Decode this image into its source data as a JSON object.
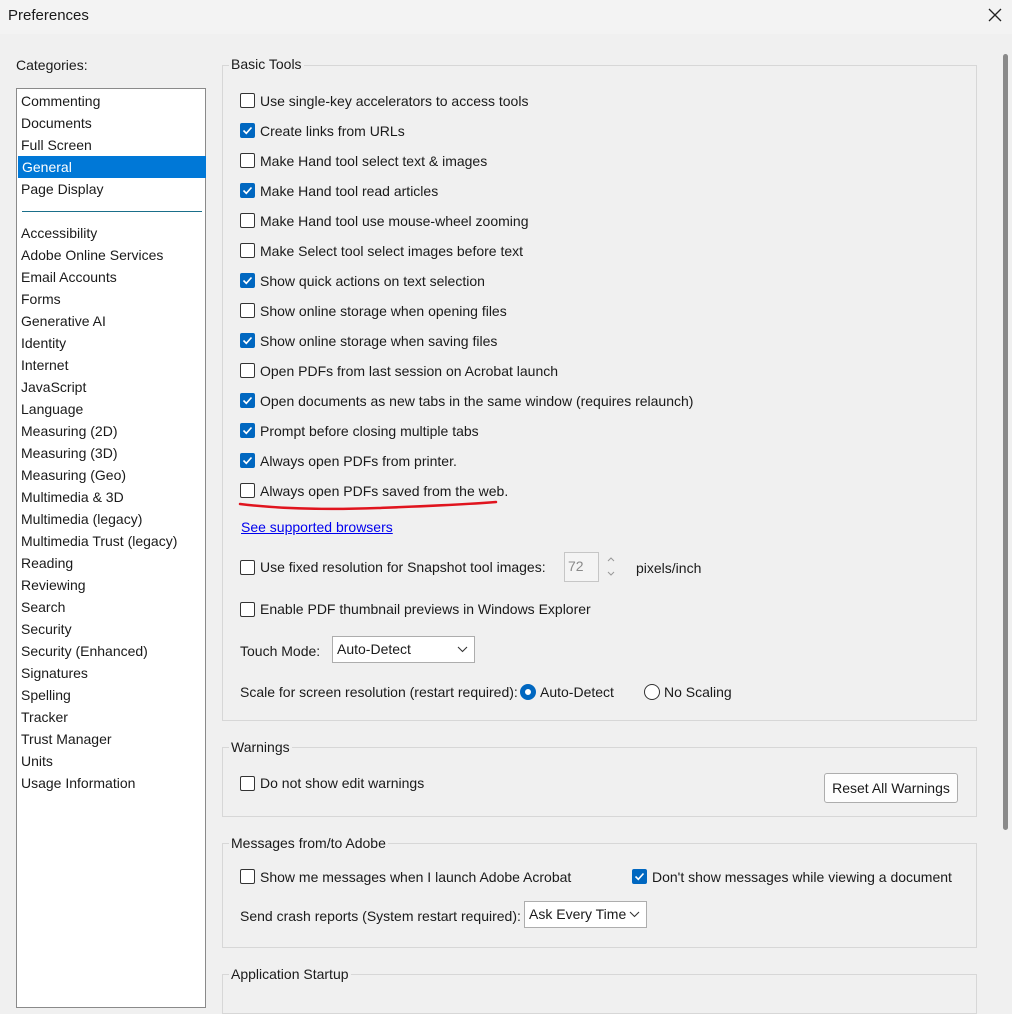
{
  "window": {
    "title": "Preferences",
    "close_icon": "close-icon"
  },
  "categories": {
    "label": "Categories:",
    "top_items": [
      "Commenting",
      "Documents",
      "Full Screen",
      "General",
      "Page Display"
    ],
    "selected": "General",
    "items": [
      "Accessibility",
      "Adobe Online Services",
      "Email Accounts",
      "Forms",
      "Generative AI",
      "Identity",
      "Internet",
      "JavaScript",
      "Language",
      "Measuring (2D)",
      "Measuring (3D)",
      "Measuring (Geo)",
      "Multimedia & 3D",
      "Multimedia (legacy)",
      "Multimedia Trust (legacy)",
      "Reading",
      "Reviewing",
      "Search",
      "Security",
      "Security (Enhanced)",
      "Signatures",
      "Spelling",
      "Tracker",
      "Trust Manager",
      "Units",
      "Usage Information"
    ]
  },
  "basic_tools": {
    "label": "Basic Tools",
    "options": [
      {
        "label": "Use single-key accelerators to access tools",
        "checked": false
      },
      {
        "label": "Create links from URLs",
        "checked": true
      },
      {
        "label": "Make Hand tool select text & images",
        "checked": false
      },
      {
        "label": "Make Hand tool read articles",
        "checked": true
      },
      {
        "label": "Make Hand tool use mouse-wheel zooming",
        "checked": false
      },
      {
        "label": "Make Select tool select images before text",
        "checked": false
      },
      {
        "label": "Show quick actions on text selection",
        "checked": true
      },
      {
        "label": "Show online storage when opening files",
        "checked": false
      },
      {
        "label": "Show online storage when saving files",
        "checked": true
      },
      {
        "label": "Open PDFs from last session on Acrobat launch",
        "checked": false
      },
      {
        "label": "Open documents as new tabs in the same window (requires relaunch)",
        "checked": true
      },
      {
        "label": "Prompt before closing multiple tabs",
        "checked": true
      },
      {
        "label": "Always open PDFs from printer.",
        "checked": true
      },
      {
        "label": "Always open PDFs saved from the web.",
        "checked": false
      }
    ],
    "see_browsers_link": "See supported browsers",
    "fixed_resolution": {
      "label": "Use fixed resolution for Snapshot tool images:",
      "checked": false,
      "value": "72",
      "unit": "pixels/inch"
    },
    "thumbnail": {
      "label": "Enable PDF thumbnail previews in Windows Explorer",
      "checked": false
    },
    "touch_mode": {
      "label": "Touch Mode:",
      "value": "Auto-Detect"
    },
    "scale": {
      "label": "Scale for screen resolution (restart required):",
      "options": [
        "Auto-Detect",
        "No Scaling"
      ],
      "selected": "Auto-Detect"
    }
  },
  "warnings": {
    "label": "Warnings",
    "option": {
      "label": "Do not show edit warnings",
      "checked": false
    },
    "reset_button": "Reset All Warnings"
  },
  "messages": {
    "label": "Messages from/to Adobe",
    "show_messages": {
      "label": "Show me messages when I launch Adobe Acrobat",
      "checked": false
    },
    "dont_show": {
      "label": "Don't show messages while viewing a document",
      "checked": true
    },
    "crash_reports": {
      "label": "Send crash reports (System restart required):",
      "value": "Ask Every Time"
    }
  },
  "startup": {
    "label": "Application Startup"
  },
  "colors": {
    "accent": "#0067c0",
    "selection": "#0078d7",
    "annotation": "#e0141e"
  }
}
